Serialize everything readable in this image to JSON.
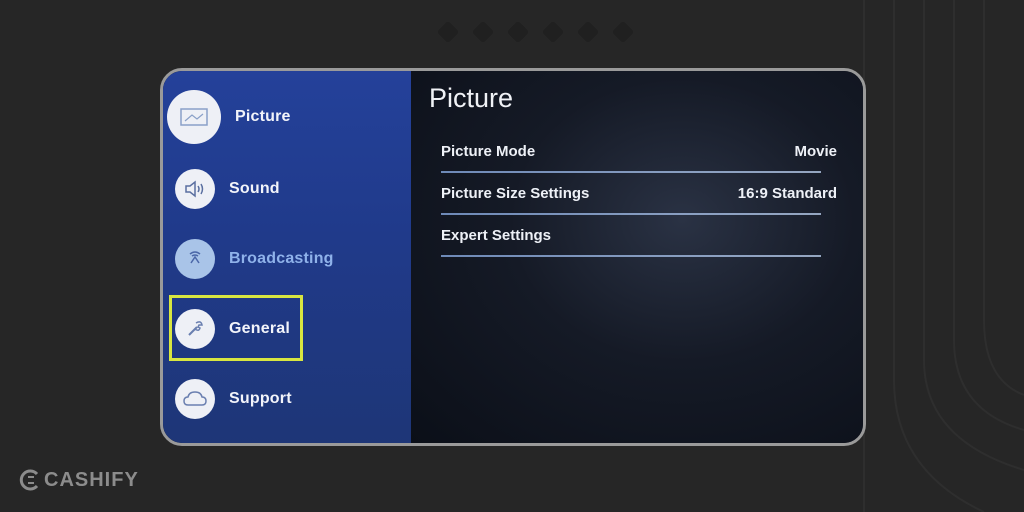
{
  "sidebar": {
    "items": [
      {
        "label": "Picture",
        "icon": "picture-icon"
      },
      {
        "label": "Sound",
        "icon": "speaker-icon"
      },
      {
        "label": "Broadcasting",
        "icon": "broadcast-icon"
      },
      {
        "label": "General",
        "icon": "wrench-icon"
      },
      {
        "label": "Support",
        "icon": "cloud-help-icon"
      }
    ],
    "selected": "General"
  },
  "main": {
    "title": "Picture",
    "rows": [
      {
        "label": "Picture Mode",
        "value": "Movie"
      },
      {
        "label": "Picture Size Settings",
        "value": "16:9 Standard"
      },
      {
        "label": "Expert Settings",
        "value": ""
      }
    ]
  },
  "brand": {
    "name": "CASHIFY"
  },
  "colors": {
    "sidebar": "#24419a",
    "highlight": "#d8e640",
    "content_bg": "#151a26",
    "frame_border": "#9a9a9a"
  }
}
